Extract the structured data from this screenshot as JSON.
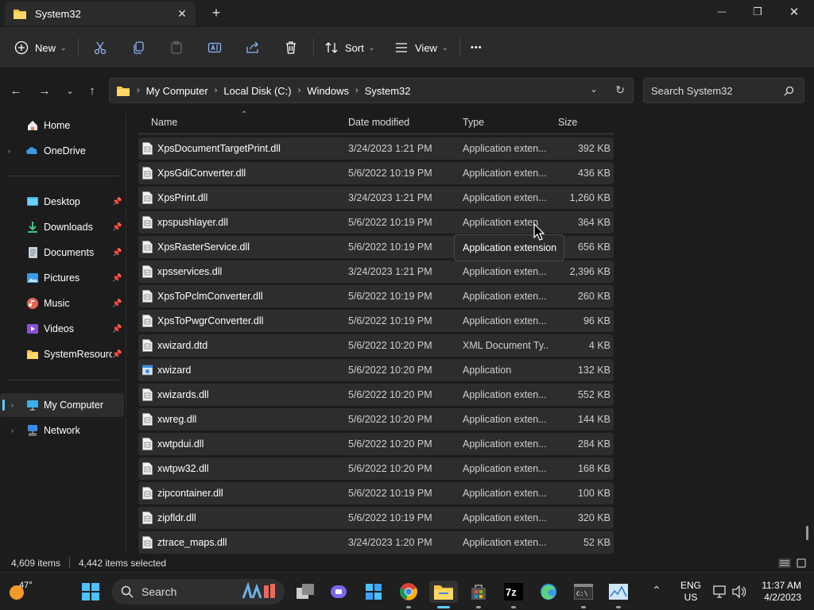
{
  "window": {
    "tab_title": "System32",
    "tab_close": "✕",
    "new_tab": "+",
    "minimize": "—",
    "maximize": "❐",
    "close": "✕"
  },
  "toolbar": {
    "new_label": "New",
    "sort_label": "Sort",
    "view_label": "View",
    "more_label": "•••"
  },
  "address": {
    "crumbs": [
      "My Computer",
      "Local Disk (C:)",
      "Windows",
      "System32"
    ],
    "search_placeholder": "Search System32"
  },
  "sidebar": {
    "items": [
      {
        "label": "Home",
        "icon": "home-icon",
        "pinned": false
      },
      {
        "label": "OneDrive",
        "icon": "onedrive-icon",
        "pinned": false
      },
      {
        "label": "Desktop",
        "icon": "desktop-icon",
        "pinned": true
      },
      {
        "label": "Downloads",
        "icon": "downloads-icon",
        "pinned": true
      },
      {
        "label": "Documents",
        "icon": "documents-icon",
        "pinned": true
      },
      {
        "label": "Pictures",
        "icon": "pictures-icon",
        "pinned": true
      },
      {
        "label": "Music",
        "icon": "music-icon",
        "pinned": true
      },
      {
        "label": "Videos",
        "icon": "videos-icon",
        "pinned": true
      },
      {
        "label": "SystemResources",
        "icon": "folder-icon",
        "pinned": true
      },
      {
        "label": "My Computer",
        "icon": "computer-icon",
        "pinned": false
      },
      {
        "label": "Network",
        "icon": "network-icon",
        "pinned": false
      }
    ]
  },
  "columns": {
    "name": "Name",
    "date": "Date modified",
    "type": "Type",
    "size": "Size"
  },
  "files": [
    {
      "name": "XpsDocumentTargetPrint.dll",
      "date": "3/24/2023 1:21 PM",
      "type": "Application exten...",
      "size": "392 KB"
    },
    {
      "name": "XpsGdiConverter.dll",
      "date": "5/6/2022 10:19 PM",
      "type": "Application exten...",
      "size": "436 KB"
    },
    {
      "name": "XpsPrint.dll",
      "date": "3/24/2023 1:21 PM",
      "type": "Application exten...",
      "size": "1,260 KB"
    },
    {
      "name": "xpspushlayer.dll",
      "date": "5/6/2022 10:19 PM",
      "type": "Application exten",
      "size": "364 KB"
    },
    {
      "name": "XpsRasterService.dll",
      "date": "5/6/2022 10:19 PM",
      "type": "",
      "size": "656 KB"
    },
    {
      "name": "xpsservices.dll",
      "date": "3/24/2023 1:21 PM",
      "type": "Application exten...",
      "size": "2,396 KB"
    },
    {
      "name": "XpsToPclmConverter.dll",
      "date": "5/6/2022 10:19 PM",
      "type": "Application exten...",
      "size": "260 KB"
    },
    {
      "name": "XpsToPwgrConverter.dll",
      "date": "5/6/2022 10:19 PM",
      "type": "Application exten...",
      "size": "96 KB"
    },
    {
      "name": "xwizard.dtd",
      "date": "5/6/2022 10:20 PM",
      "type": "XML Document Ty...",
      "size": "4 KB"
    },
    {
      "name": "xwizard",
      "date": "5/6/2022 10:20 PM",
      "type": "Application",
      "size": "132 KB"
    },
    {
      "name": "xwizards.dll",
      "date": "5/6/2022 10:20 PM",
      "type": "Application exten...",
      "size": "552 KB"
    },
    {
      "name": "xwreg.dll",
      "date": "5/6/2022 10:20 PM",
      "type": "Application exten...",
      "size": "144 KB"
    },
    {
      "name": "xwtpdui.dll",
      "date": "5/6/2022 10:20 PM",
      "type": "Application exten...",
      "size": "284 KB"
    },
    {
      "name": "xwtpw32.dll",
      "date": "5/6/2022 10:20 PM",
      "type": "Application exten...",
      "size": "168 KB"
    },
    {
      "name": "zipcontainer.dll",
      "date": "5/6/2022 10:19 PM",
      "type": "Application exten...",
      "size": "100 KB"
    },
    {
      "name": "zipfldr.dll",
      "date": "5/6/2022 10:19 PM",
      "type": "Application exten...",
      "size": "320 KB"
    },
    {
      "name": "ztrace_maps.dll",
      "date": "3/24/2023 1:20 PM",
      "type": "Application exten...",
      "size": "52 KB"
    }
  ],
  "tooltip": "Application extension",
  "status": {
    "items": "4,609 items",
    "selected": "4,442 items selected"
  },
  "taskbar": {
    "weather_temp": "47°",
    "search_label": "Search",
    "lang": "ENG",
    "region": "US",
    "time": "11:37 AM",
    "date": "4/2/2023"
  },
  "colors": {
    "accent": "#60cdff",
    "folder": "#f5c342",
    "row_bg": "#2d2d2d"
  }
}
